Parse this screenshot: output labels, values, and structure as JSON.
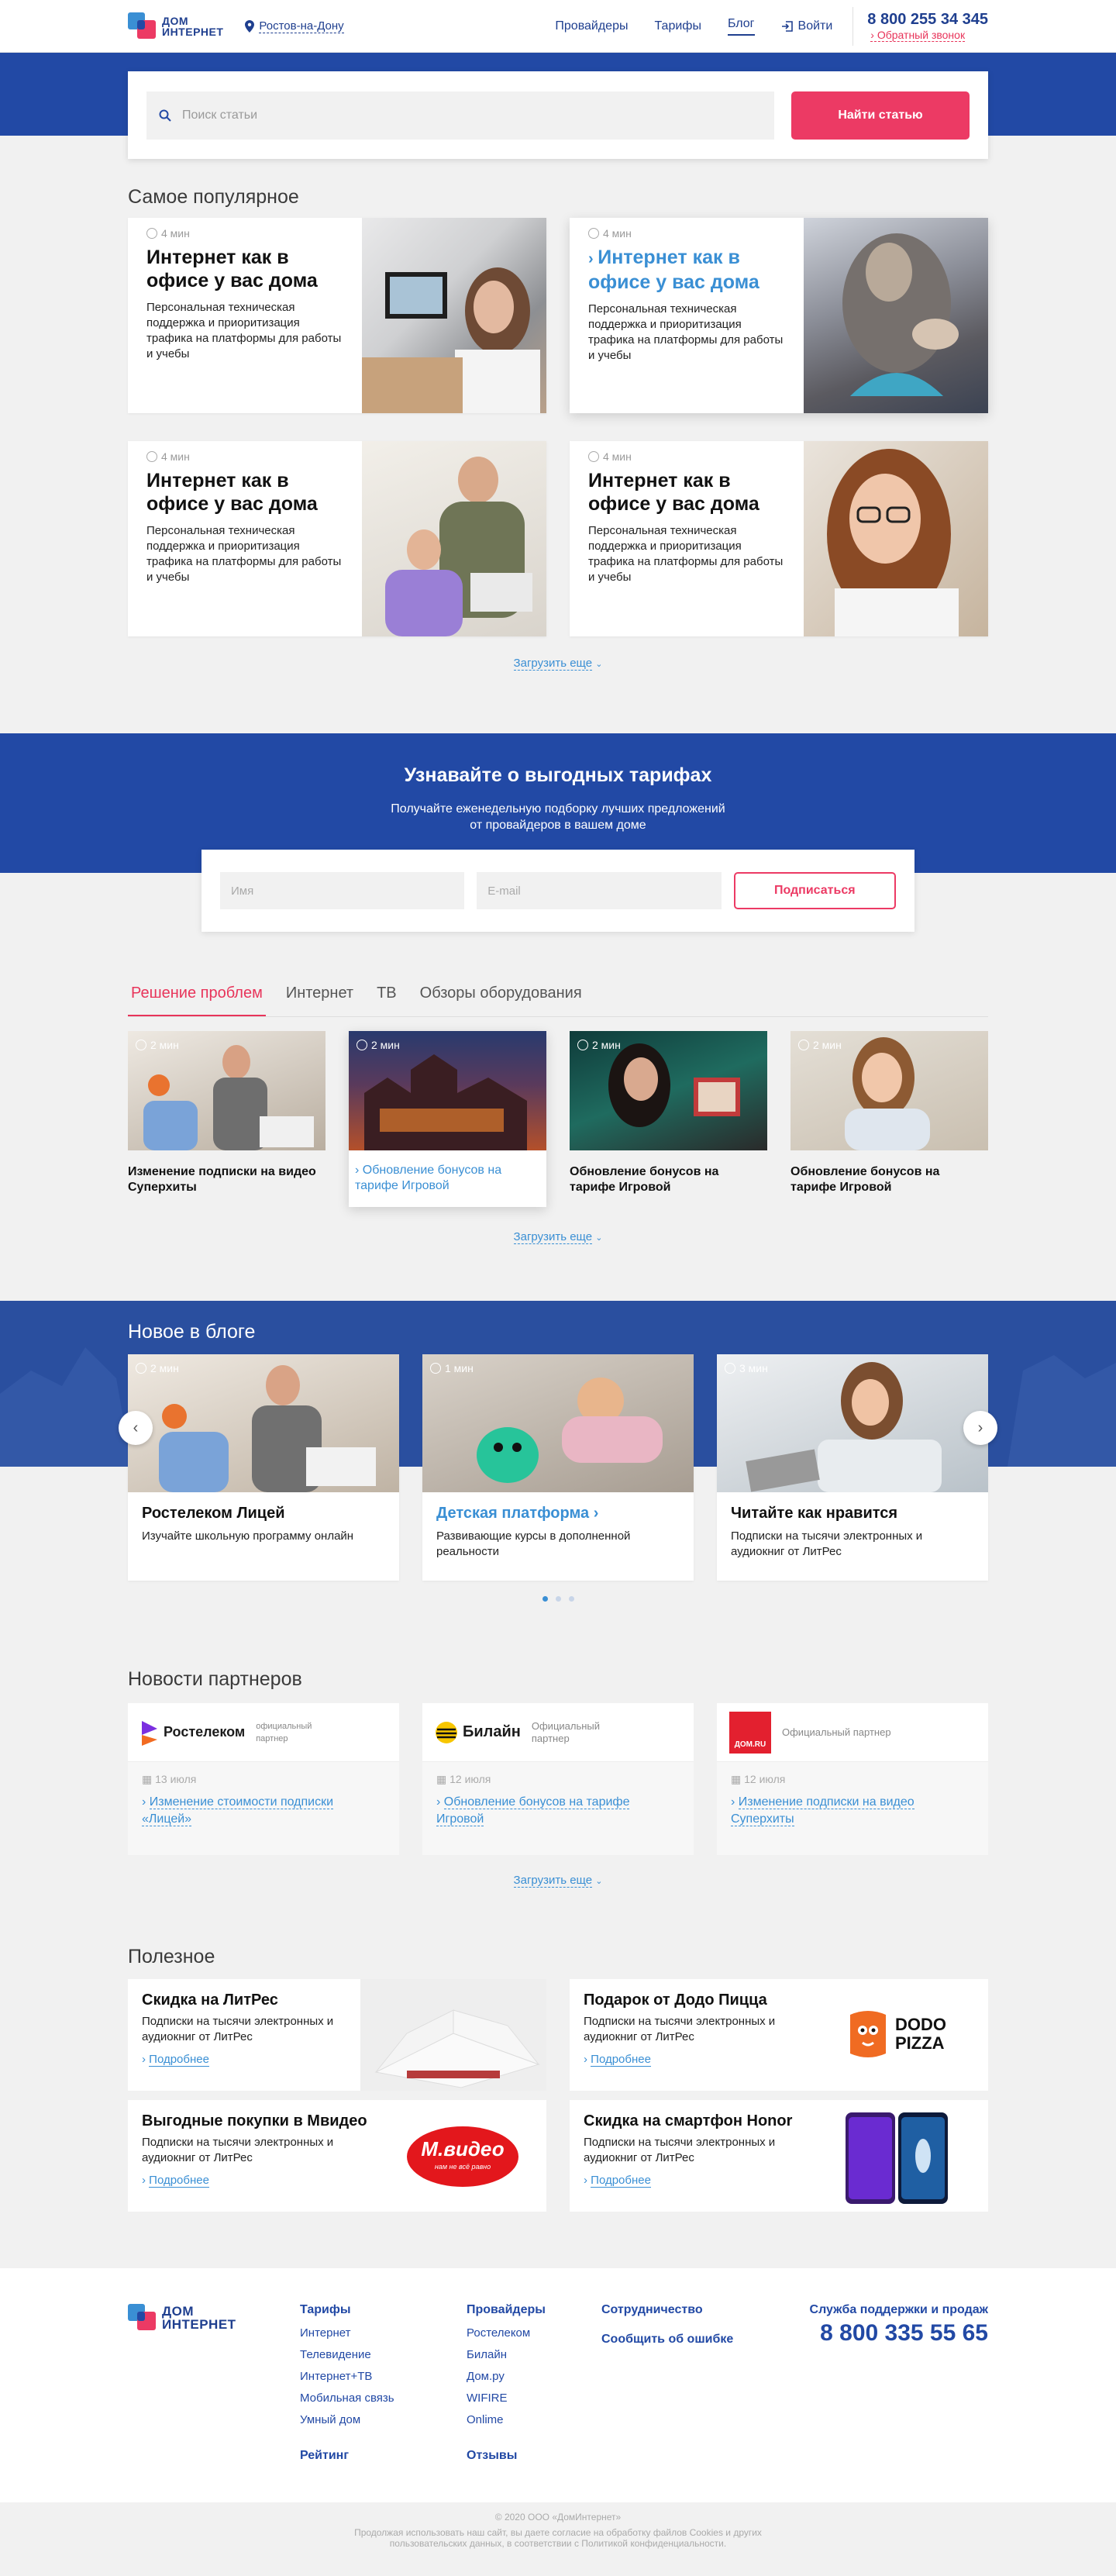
{
  "header": {
    "logo_line1": "ДОМ",
    "logo_line2": "ИНТЕРНЕТ",
    "city": "Ростов-на-Дону",
    "nav": [
      "Провайдеры",
      "Тарифы",
      "Блог",
      "Войти"
    ],
    "phone": "8 800 255 34 345",
    "callback": "Обратный звонок"
  },
  "search": {
    "placeholder": "Поиск статьи",
    "button": "Найти статью"
  },
  "popular": {
    "title": "Самое популярное",
    "cards": [
      {
        "time": "4 мин",
        "title": "Интернет как в офисе у вас дома",
        "text": "Персональная техническая поддержка и приоритизация трафика на платформы для работы и учебы"
      },
      {
        "time": "4 мин",
        "title": "Интернет как в офисе у вас дома",
        "text": "Персональная техническая поддержка и приоритизация трафика на платформы для работы и учебы"
      },
      {
        "time": "4 мин",
        "title": "Интернет как в офисе у вас дома",
        "text": "Персональная техническая поддержка и приоритизация трафика на платформы для работы и учебы"
      },
      {
        "time": "4 мин",
        "title": "Интернет как в офисе у вас дома",
        "text": "Персональная техническая поддержка и приоритизация трафика на платформы для работы и учебы"
      }
    ],
    "more": "Загрузить еще"
  },
  "subscribe": {
    "title": "Узнавайте о выгодных тарифах",
    "line1": "Получайте еженедельную подборку лучших предложений",
    "line2": "от провайдеров в вашем доме",
    "name_placeholder": "Имя",
    "email_placeholder": "E-mail",
    "button": "Подписаться"
  },
  "topics": {
    "tabs": [
      "Решение проблем",
      "Интернет",
      "ТВ",
      "Обзоры оборудования"
    ],
    "cards": [
      {
        "time": "2 мин",
        "title": "Изменение подписки на видео Суперхиты"
      },
      {
        "time": "2 мин",
        "title": "Обновление бонусов на тарифе Игровой"
      },
      {
        "time": "2 мин",
        "title": "Обновление бонусов на тарифе Игровой"
      },
      {
        "time": "2 мин",
        "title": "Обновление бонусов на тарифе Игровой"
      }
    ],
    "more": "Загрузить еще"
  },
  "blog": {
    "title": "Новое в блоге",
    "cards": [
      {
        "time": "2 мин",
        "title": "Ростелеком Лицей",
        "text": "Изучайте школьную программу онлайн"
      },
      {
        "time": "1 мин",
        "title": "Детская платформа",
        "text": "Развивающие курсы в дополненной реальности"
      },
      {
        "time": "3 мин",
        "title": "Читайте как нравится",
        "text": "Подписки на тысячи электронных и аудиокниг от ЛитРес"
      }
    ]
  },
  "partners": {
    "title": "Новости партнеров",
    "cards": [
      {
        "brand": "Ростелеком",
        "label": "официальный партнер",
        "date": "13 июля",
        "link": "Изменение стоимости подписки «Лицей»"
      },
      {
        "brand": "Билайн",
        "label": "Официальный партнер",
        "date": "12 июля",
        "link": "Обновление бонусов на тарифе Игровой"
      },
      {
        "brand": "ДОМ.RU",
        "label": "Официальный партнер",
        "date": "12 июля",
        "link": "Изменение подписки на видео Суперхиты"
      }
    ],
    "more": "Загрузить еще"
  },
  "useful": {
    "title": "Полезное",
    "cards": [
      {
        "title": "Скидка на ЛитРес",
        "text": "Подписки на тысячи электронных и аудиокниг от ЛитРес",
        "link": "Подробнее"
      },
      {
        "title": "Подарок от Додо Пицца",
        "text": "Подписки на тысячи электронных и аудиокниг от ЛитРес",
        "link": "Подробнее",
        "brand": "DODO PIZZA"
      },
      {
        "title": "Выгодные покупки в Мвидео",
        "text": "Подписки на тысячи электронных и аудиокниг от ЛитРес",
        "link": "Подробнее",
        "brand": "М.видео",
        "slogan": "нам не всё равно"
      },
      {
        "title": "Скидка на смартфон Honor",
        "text": "Подписки на тысячи электронных и аудиокниг от ЛитРес",
        "link": "Подробнее"
      }
    ]
  },
  "footer": {
    "tariffs": {
      "head": "Тарифы",
      "items": [
        "Интернет",
        "Телевидение",
        "Интернет+ТВ",
        "Мобильная связь",
        "Умный дом"
      ]
    },
    "providers": {
      "head": "Провайдеры",
      "items": [
        "Ростелеком",
        "Билайн",
        "Дом.ру",
        "WIFIRE",
        "Onlime"
      ]
    },
    "rating": "Рейтинг",
    "reviews": "Отзывы",
    "coop": "Сотрудничество",
    "report": "Сообщить об ошибке",
    "support": "Служба поддержки и продаж",
    "phone": "8 800 335 55 65",
    "copyright": "© 2020 ООО «ДомИнтернет»",
    "notice1": "Продолжая использовать наш сайт, вы даете согласие на обработку файлов Cookies и других",
    "notice2": "пользовательских данных, в соответствии с Политикой конфиденциальности."
  },
  "colors": {
    "brand": "#2249a5",
    "accent": "#ec3a64",
    "link": "#3a8fd4"
  }
}
